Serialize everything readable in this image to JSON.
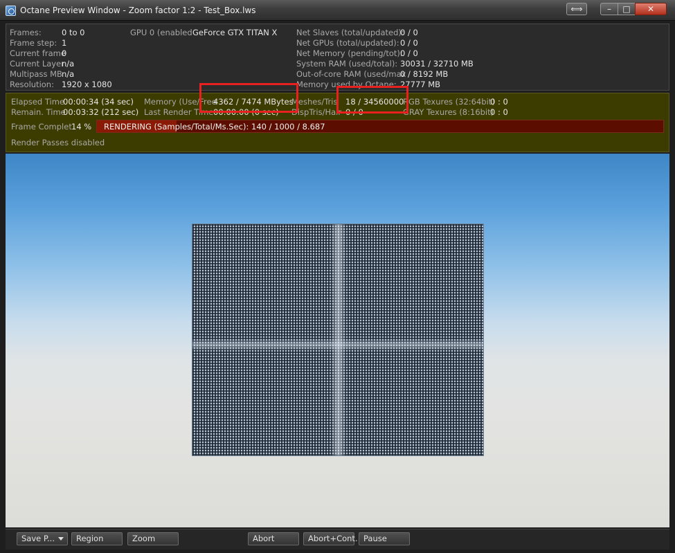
{
  "window": {
    "title": "Octane Preview Window - Zoom factor 1:2 - Test_Box.lws",
    "resize_icon": "double-arrow-icon",
    "min_icon": "minimize-icon",
    "max_icon": "maximize-icon",
    "close_icon": "close-icon"
  },
  "info": {
    "frames_label": "Frames:",
    "frames_value": "0 to 0",
    "frame_step_label": "Frame step:",
    "frame_step_value": "1",
    "current_frame_label": "Current frame",
    "current_frame_value": "0",
    "current_layer_label": "Current Layer",
    "current_layer_value": "n/a",
    "multipass_label": "Multipass MB",
    "multipass_value": "n/a",
    "resolution_label": "Resolution:",
    "resolution_value": "1920 x 1080",
    "gpu_label": "GPU  0 (enabled",
    "gpu_value": "GeForce GTX TITAN X",
    "net_slaves_label": "Net Slaves (total/updated):",
    "net_slaves_value": "0 / 0",
    "net_gpus_label": "Net GPUs (total/updated):",
    "net_gpus_value": "0 / 0",
    "net_memory_label": "Net Memory (pending/tot):",
    "net_memory_value": "0 / 0",
    "system_ram_label": "System RAM (used/total):",
    "system_ram_value": "30031 / 32710 MB",
    "ooc_ram_label": "Out-of-core RAM (used/max",
    "ooc_ram_value": "0 / 8192 MB",
    "mem_octane_label": "Memory used by Octane:",
    "mem_octane_value": "27777 MB"
  },
  "status": {
    "elapsed_label": "Elapsed Time",
    "elapsed_value": "00:00:34 (34 sec)",
    "remain_label": "Remain. Time",
    "remain_value": "00:03:32 (212 sec)",
    "memory_label": "Memory (Use/Free",
    "memory_value": "4362 / 7474 MBytes",
    "last_render_label": "Last Render Time",
    "last_render_value": "00:00:00 (0 sec)",
    "meshes_label": "Meshes/Tris",
    "meshes_value": "18 / 34560000",
    "disp_label": "DispTris/Hair",
    "disp_value": "0 / 0",
    "rgb_tex_label": "RGB Texures (32:64bit)",
    "rgb_tex_value": "0 : 0",
    "gray_tex_label": "GRAY Texures (8:16bit)",
    "gray_tex_value": "0 : 0",
    "frame_complete_label": "Frame Complet",
    "frame_complete_value": "14 %",
    "progress": 0.14,
    "progress_text": "RENDERING (Samples/Total/Ms.Sec): 140 / 1000 / 8.687",
    "render_passes": "Render Passes disabled"
  },
  "toolbar": {
    "save_label": "Save P...",
    "region_label": "Region",
    "zoom_label": "Zoom",
    "abort_label": "Abort",
    "abort_cont_label": "Abort+Cont.",
    "pause_label": "Pause"
  },
  "colors": {
    "status_bg": "#3c3b00",
    "progress_bg": "#5b0d00",
    "highlight": "#e82020"
  }
}
